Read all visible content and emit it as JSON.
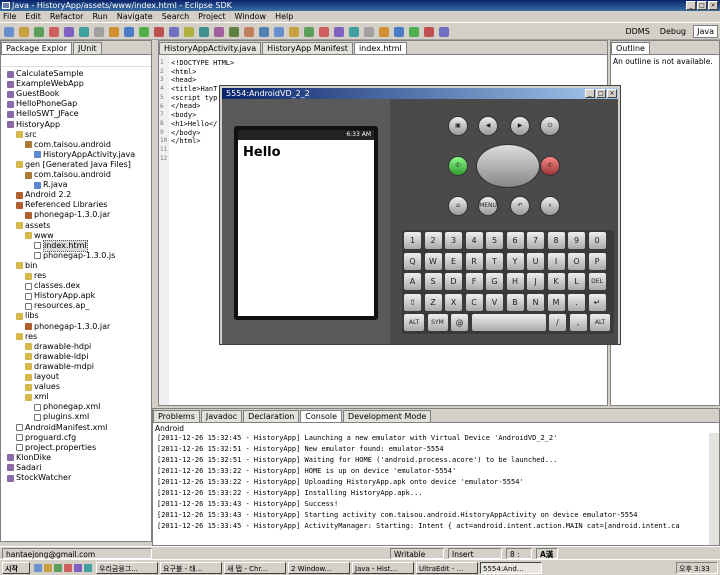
{
  "window": {
    "title": "Java - HistoryApp/assets/www/index.html - Eclipse SDK"
  },
  "menu": [
    "File",
    "Edit",
    "Refactor",
    "Run",
    "Navigate",
    "Search",
    "Project",
    "Window",
    "Help"
  ],
  "perspectives": [
    "DDMS",
    "Debug",
    "Java"
  ],
  "explorer": {
    "tabs": [
      "Package Explor",
      "JUnit"
    ],
    "items": [
      {
        "label": "CalculateSample",
        "indent": 0,
        "icon": "proj"
      },
      {
        "label": "ExampleWebApp",
        "indent": 0,
        "icon": "proj"
      },
      {
        "label": "GuestBook",
        "indent": 0,
        "icon": "proj"
      },
      {
        "label": "HelloPhoneGap",
        "indent": 0,
        "icon": "proj"
      },
      {
        "label": "HelloSWT_JFace",
        "indent": 0,
        "icon": "proj"
      },
      {
        "label": "HistoryApp",
        "indent": 0,
        "icon": "proj"
      },
      {
        "label": "src",
        "indent": 1,
        "icon": "fold"
      },
      {
        "label": "com.taisou.android",
        "indent": 2,
        "icon": "pkg"
      },
      {
        "label": "HistoryAppActivity.java",
        "indent": 3,
        "icon": "jfile"
      },
      {
        "label": "gen [Generated Java Files]",
        "indent": 1,
        "icon": "fold"
      },
      {
        "label": "com.taisou.android",
        "indent": 2,
        "icon": "pkg"
      },
      {
        "label": "R.java",
        "indent": 3,
        "icon": "jfile"
      },
      {
        "label": "Android 2.2",
        "indent": 1,
        "icon": "jar"
      },
      {
        "label": "Referenced Libraries",
        "indent": 1,
        "icon": "jar"
      },
      {
        "label": "phonegap-1.3.0.jar",
        "indent": 2,
        "icon": "jar"
      },
      {
        "label": "assets",
        "indent": 1,
        "icon": "fold"
      },
      {
        "label": "www",
        "indent": 2,
        "icon": "fold"
      },
      {
        "label": "index.html",
        "indent": 3,
        "icon": "file"
      },
      {
        "label": "phonegap-1.3.0.js",
        "indent": 3,
        "icon": "file"
      },
      {
        "label": "bin",
        "indent": 1,
        "icon": "fold"
      },
      {
        "label": "res",
        "indent": 2,
        "icon": "fold"
      },
      {
        "label": "classes.dex",
        "indent": 2,
        "icon": "file"
      },
      {
        "label": "HistoryApp.apk",
        "indent": 2,
        "icon": "file"
      },
      {
        "label": "resources.ap_",
        "indent": 2,
        "icon": "file"
      },
      {
        "label": "libs",
        "indent": 1,
        "icon": "fold"
      },
      {
        "label": "phonegap-1.3.0.jar",
        "indent": 2,
        "icon": "jar"
      },
      {
        "label": "res",
        "indent": 1,
        "icon": "fold"
      },
      {
        "label": "drawable-hdpi",
        "indent": 2,
        "icon": "fold"
      },
      {
        "label": "drawable-ldpi",
        "indent": 2,
        "icon": "fold"
      },
      {
        "label": "drawable-mdpi",
        "indent": 2,
        "icon": "fold"
      },
      {
        "label": "layout",
        "indent": 2,
        "icon": "fold"
      },
      {
        "label": "values",
        "indent": 2,
        "icon": "fold"
      },
      {
        "label": "xml",
        "indent": 2,
        "icon": "fold"
      },
      {
        "label": "phonegap.xml",
        "indent": 3,
        "icon": "file"
      },
      {
        "label": "plugins.xml",
        "indent": 3,
        "icon": "file"
      },
      {
        "label": "AndroidManifest.xml",
        "indent": 1,
        "icon": "file"
      },
      {
        "label": "proguard.cfg",
        "indent": 1,
        "icon": "file"
      },
      {
        "label": "project.properties",
        "indent": 1,
        "icon": "file"
      },
      {
        "label": "KlonDike",
        "indent": 0,
        "icon": "proj"
      },
      {
        "label": "Sadari",
        "indent": 0,
        "icon": "proj"
      },
      {
        "label": "StockWatcher",
        "indent": 0,
        "icon": "proj"
      }
    ]
  },
  "editor": {
    "tabs": [
      "HistoryAppActivity.java",
      "HistoryApp Manifest",
      "index.html"
    ],
    "lines": [
      "<!DOCTYPE HTML>",
      "<html>",
      "<head>",
      "<title>HanT",
      "<script typ",
      "</head>",
      "<body>",
      "<h1>Hello</",
      "</body>",
      "</html>"
    ],
    "line_numbers": [
      "1",
      "2",
      "3",
      "4",
      "5",
      "6",
      "7",
      "8",
      "9",
      "10",
      "11",
      "12"
    ]
  },
  "outline": {
    "tab": "Outline",
    "message": "An outline is not available."
  },
  "emulator": {
    "title": "5554:AndroidVD_2_2",
    "time": "6:33 AM",
    "content": "Hello",
    "buttons": {
      "camera": "▣",
      "vol_down": "◀",
      "vol_up": "▶",
      "power": "⏻",
      "home": "⌂",
      "menu": "MENU",
      "back": "↶",
      "search": "⌕"
    },
    "keys": [
      [
        "1",
        "2",
        "3",
        "4",
        "5",
        "6",
        "7",
        "8",
        "9",
        "0"
      ],
      [
        "Q",
        "W",
        "E",
        "R",
        "T",
        "Y",
        "U",
        "I",
        "O",
        "P"
      ],
      [
        "A",
        "S",
        "D",
        "F",
        "G",
        "H",
        "J",
        "K",
        "L",
        "DEL"
      ],
      [
        "⇧",
        "Z",
        "X",
        "C",
        "V",
        "B",
        "N",
        "M",
        ".",
        "↵"
      ],
      [
        "ALT",
        "SYM",
        "@",
        "",
        "/",
        ",",
        "ALT"
      ]
    ]
  },
  "console": {
    "tabs": [
      "Problems",
      "Javadoc",
      "Declaration",
      "Console",
      "Development Mode"
    ],
    "header": "Android",
    "lines": [
      "[2011-12-26 15:32:45 - HistoryApp] Launching a new emulator with Virtual Device 'AndroidVD_2_2'",
      "[2011-12-26 15:32:51 - HistoryApp] New emulator found: emulator-5554",
      "[2011-12-26 15:32:51 - HistoryApp] Waiting for HOME ('android.process.acore') to be launched...",
      "[2011-12-26 15:33:22 - HistoryApp] HOME is up on device 'emulator-5554'",
      "[2011-12-26 15:33:22 - HistoryApp] Uploading HistoryApp.apk onto device 'emulator-5554'",
      "[2011-12-26 15:33:22 - HistoryApp] Installing HistoryApp.apk...",
      "[2011-12-26 15:33:43 - HistoryApp] Success!",
      "[2011-12-26 15:33:43 - HistoryApp] Starting activity com.taisou.android.HistoryAppActivity on device emulator-5554",
      "[2011-12-26 15:33:45 - HistoryApp] ActivityManager: Starting: Intent { act=android.intent.action.MAIN cat=[android.intent.ca"
    ]
  },
  "statusbar": {
    "user": "hantaejong@gmail.com",
    "writable": "Writable",
    "insert": "Insert",
    "position": "8 : 15",
    "ime": "A漢"
  },
  "taskbar": {
    "start": "시작",
    "items": [
      "우리금융그...",
      "요구불 - 태...",
      "새 탭 - Chr...",
      "2 Window...",
      "Java - Hist...",
      "UltraEdit - ...",
      "5554:And..."
    ],
    "clock": "오후 3:33"
  }
}
